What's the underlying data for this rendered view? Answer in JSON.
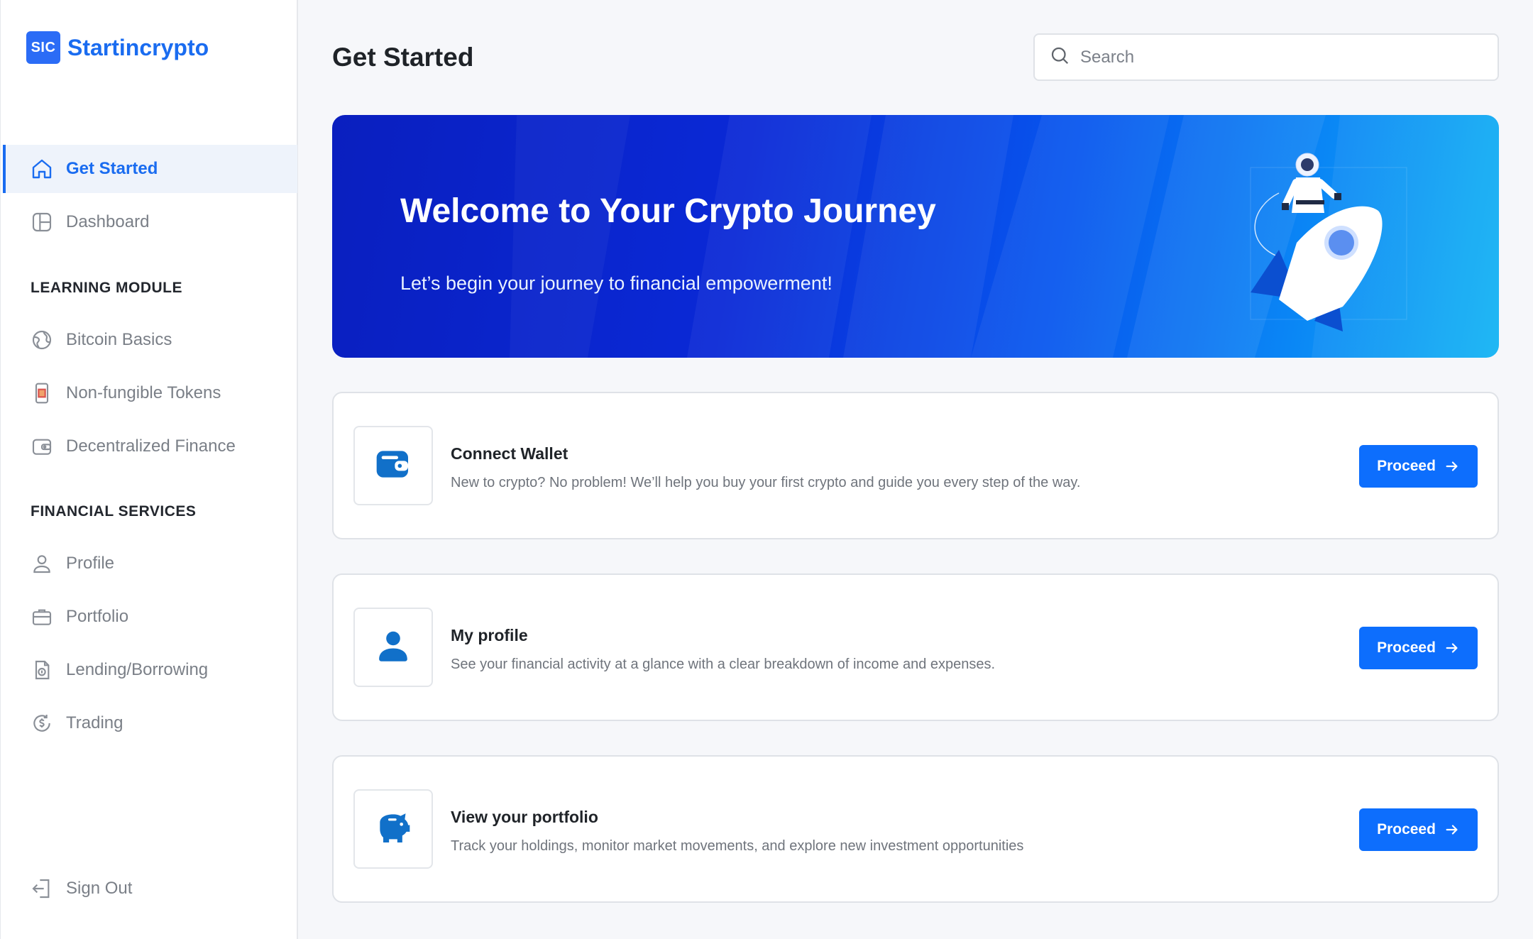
{
  "brand": {
    "badge": "SIC",
    "name": "Startincrypto"
  },
  "sidebar": {
    "primary": [
      {
        "label": "Get Started",
        "icon": "home-icon",
        "active": true
      },
      {
        "label": "Dashboard",
        "icon": "layout-icon",
        "active": false
      }
    ],
    "learning_heading": "LEARNING MODULE",
    "learning": [
      {
        "label": "Bitcoin Basics",
        "icon": "globe-icon"
      },
      {
        "label": "Non-fungible Tokens",
        "icon": "phone-image-icon"
      },
      {
        "label": "Decentralized Finance",
        "icon": "wallet-icon"
      }
    ],
    "financial_heading": "FINANCIAL SERVICES",
    "financial": [
      {
        "label": "Profile",
        "icon": "user-icon"
      },
      {
        "label": "Portfolio",
        "icon": "briefcase-icon"
      },
      {
        "label": "Lending/Borrowing",
        "icon": "document-exchange-icon"
      },
      {
        "label": "Trading",
        "icon": "dollar-cycle-icon"
      }
    ],
    "signout": {
      "label": "Sign Out",
      "icon": "logout-icon"
    }
  },
  "header": {
    "title": "Get Started",
    "search_placeholder": "Search"
  },
  "hero": {
    "title": "Welcome to Your Crypto Journey",
    "subtitle": "Let’s begin your journey to financial empowerment!"
  },
  "cards": [
    {
      "title": "Connect Wallet",
      "description": "New to crypto? No problem! We’ll help you buy your first crypto and guide you every step of the way.",
      "icon": "wallet-icon",
      "button": "Proceed"
    },
    {
      "title": "My profile",
      "description": "See your financial activity at a glance with a clear breakdown of income and expenses.",
      "icon": "user-icon",
      "button": "Proceed"
    },
    {
      "title": "View your portfolio",
      "description": "Track your holdings, monitor market movements, and explore new investment opportunities",
      "icon": "piggy-bank-icon",
      "button": "Proceed"
    }
  ],
  "colors": {
    "accent": "#0d6efd",
    "brand": "#1a6cf0",
    "card_icon": "#1170c9"
  }
}
